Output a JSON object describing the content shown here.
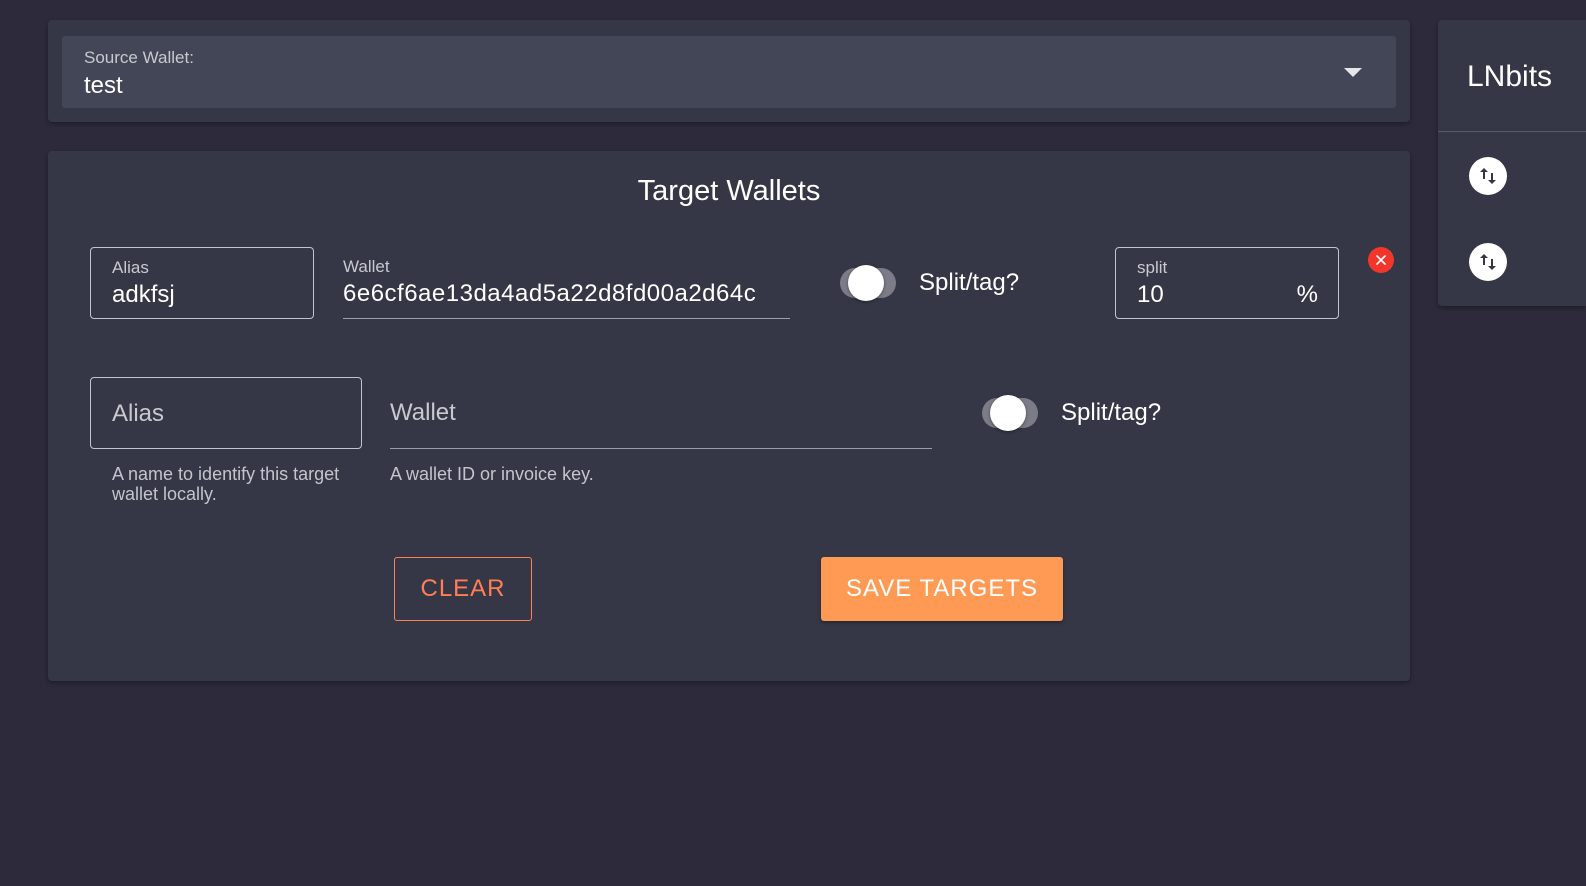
{
  "source": {
    "label": "Source Wallet:",
    "value": "test"
  },
  "targets": {
    "title": "Target Wallets",
    "row1": {
      "alias_label": "Alias",
      "alias_value": "adkfsj",
      "wallet_label": "Wallet",
      "wallet_value": "6e6cf6ae13da4ad5a22d8fd00a2d64c",
      "toggle_label": "Split/tag?",
      "split_label": "split",
      "split_value": "10",
      "split_suffix": "%"
    },
    "row2": {
      "alias_placeholder": "Alias",
      "alias_hint": "A name to identify this target wallet locally.",
      "wallet_placeholder": "Wallet",
      "wallet_hint": "A wallet ID or invoice key.",
      "toggle_label": "Split/tag?"
    },
    "clear_label": "CLEAR",
    "save_label": "SAVE TARGETS"
  },
  "sidebar": {
    "title": "LNbits"
  },
  "colors": {
    "background": "#2d2b3b",
    "card": "#353746",
    "accent": "#ff9a55",
    "danger": "#f2362b"
  },
  "icons": {
    "caret": "chevron-down-icon",
    "remove": "close-icon",
    "swap": "swap-vertical-icon"
  }
}
